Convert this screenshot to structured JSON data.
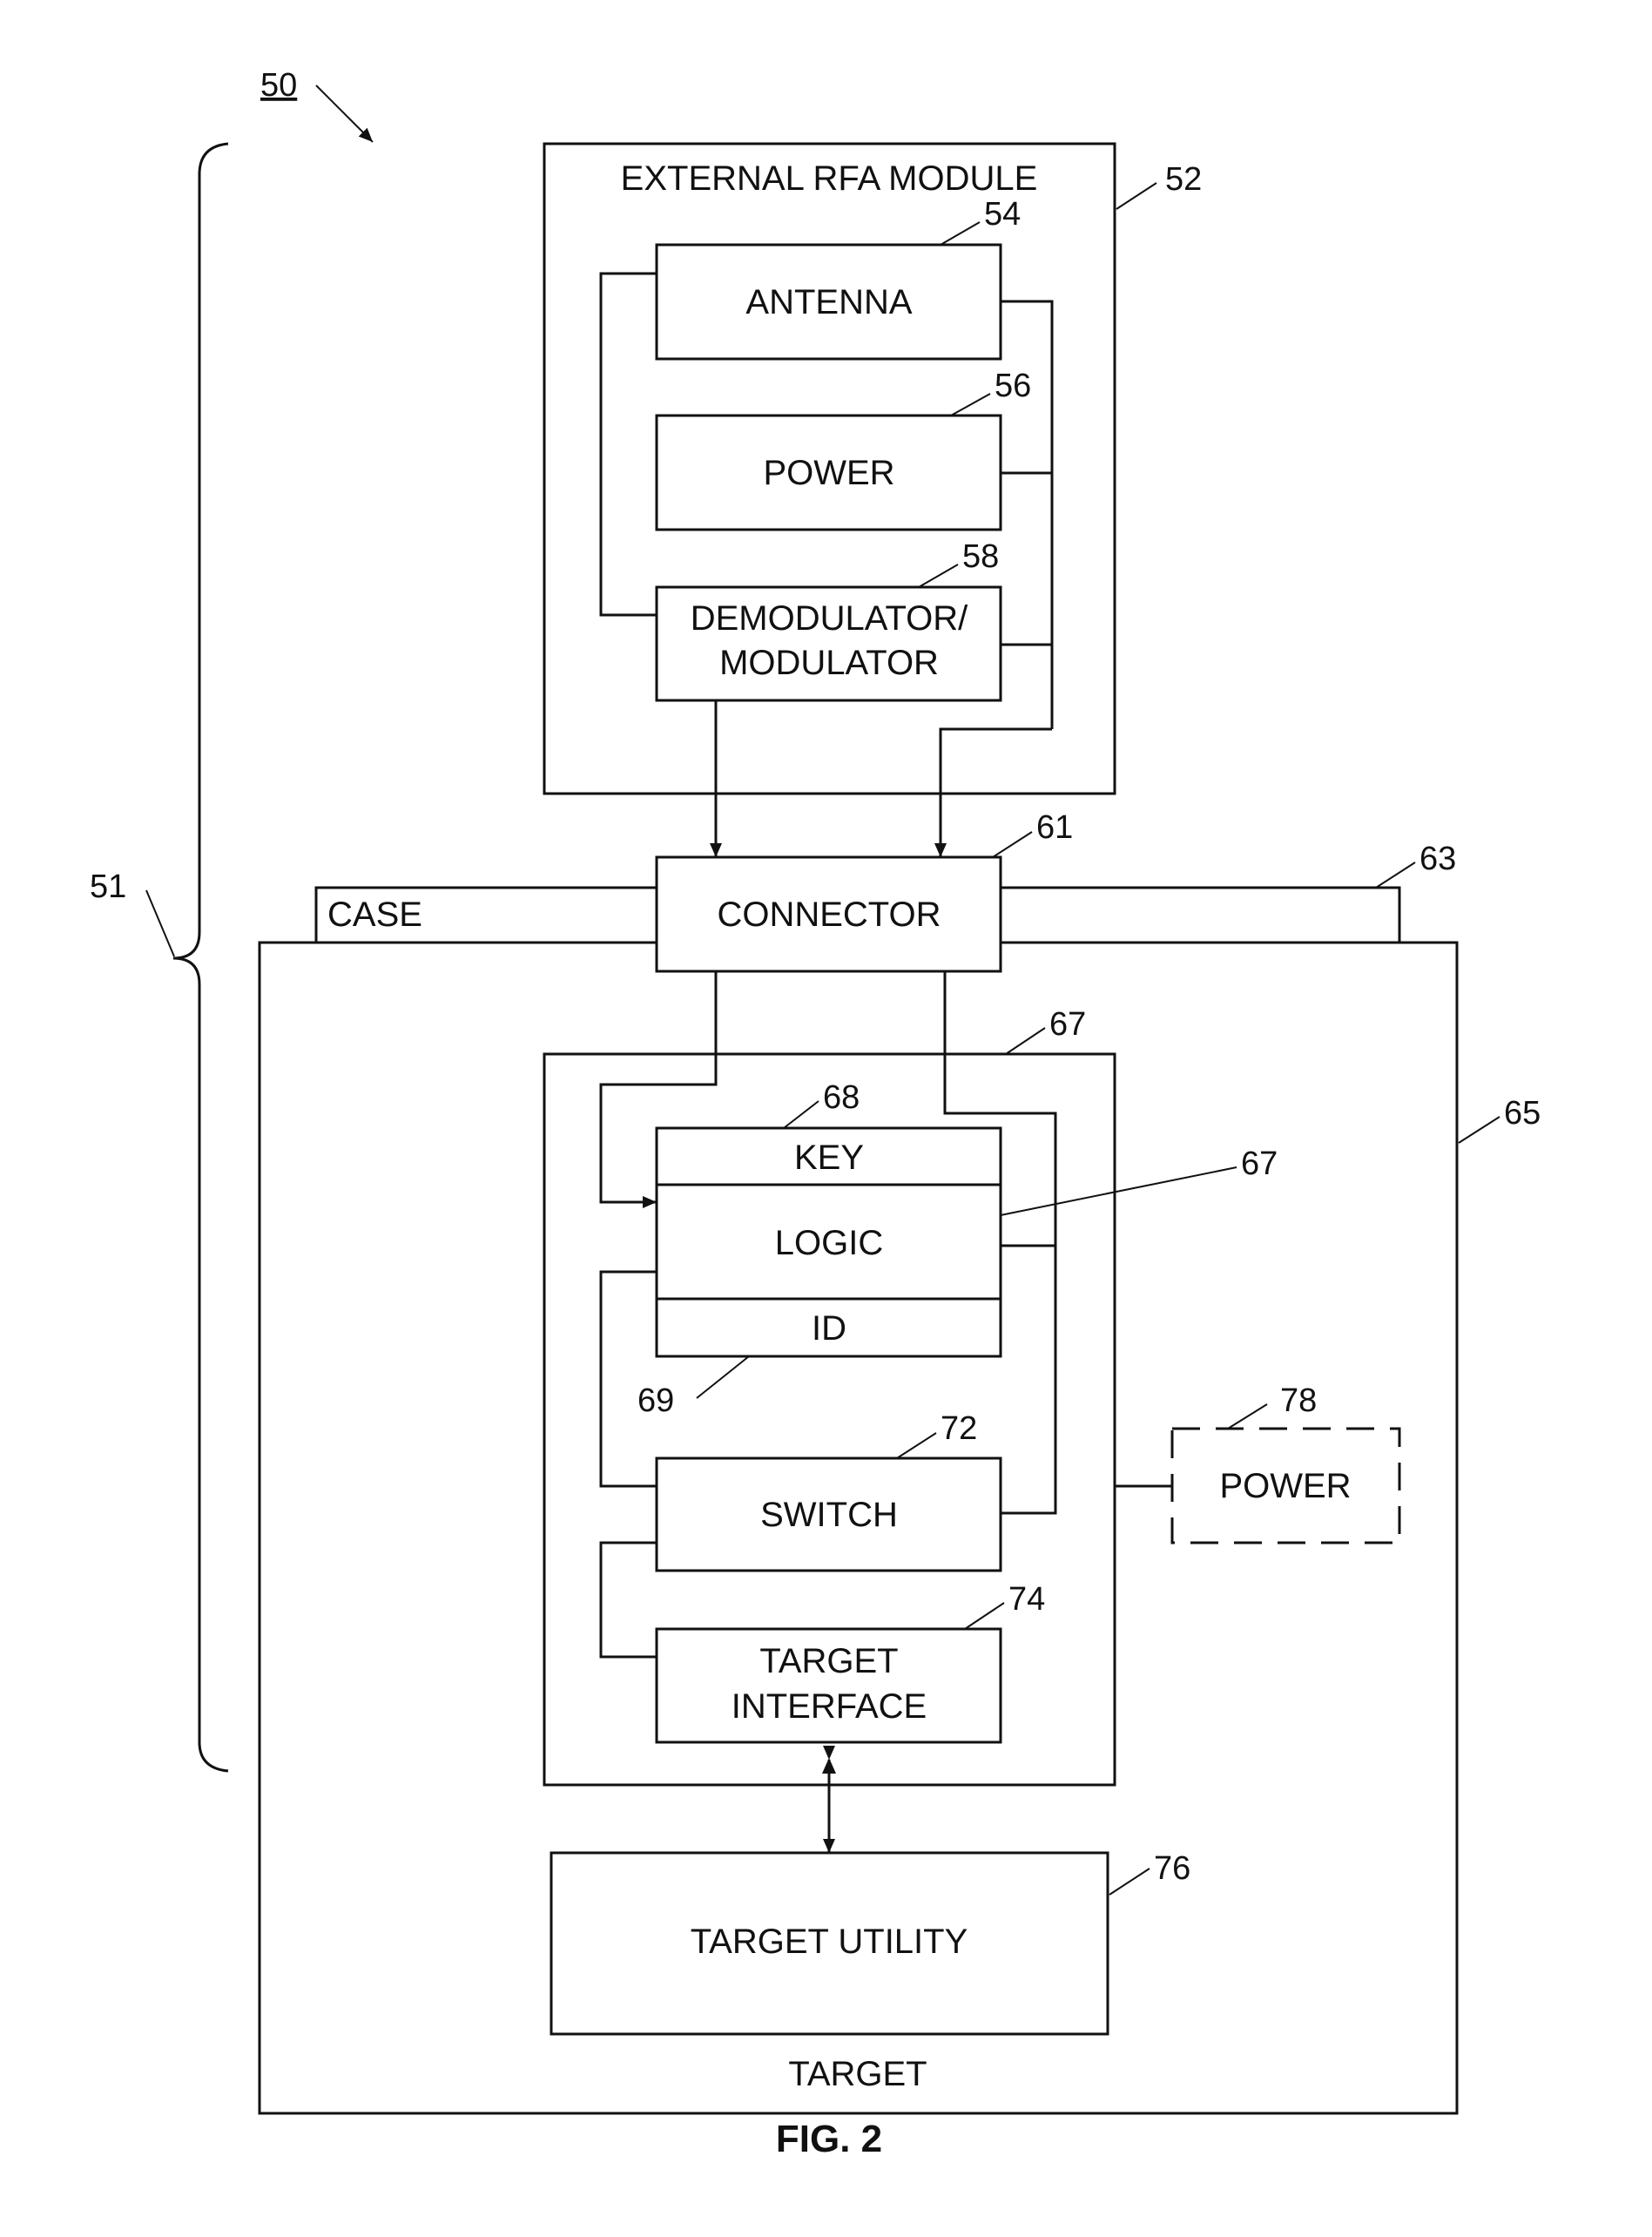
{
  "figure": {
    "caption": "FIG. 2",
    "system_ref": "50",
    "bracket_ref": "51"
  },
  "external_module": {
    "title": "EXTERNAL RFA MODULE",
    "ref": "52",
    "blocks": {
      "antenna": {
        "label": "ANTENNA",
        "ref": "54"
      },
      "power": {
        "label": "POWER",
        "ref": "56"
      },
      "demod_line1": "DEMODULATOR/",
      "demod_line2": "MODULATOR",
      "demod_ref": "58"
    }
  },
  "connector": {
    "label": "CONNECTOR",
    "ref": "61"
  },
  "case": {
    "label": "CASE",
    "ref": "63"
  },
  "target": {
    "label": "TARGET",
    "ref": "65",
    "module_ref": "67",
    "key": {
      "label": "KEY",
      "ref": "68"
    },
    "logic": {
      "label": "LOGIC",
      "ref": "67"
    },
    "id": {
      "label": "ID",
      "ref": "69"
    },
    "switch": {
      "label": "SWITCH",
      "ref": "72"
    },
    "target_interface_line1": "TARGET",
    "target_interface_line2": "INTERFACE",
    "target_interface_ref": "74",
    "target_utility": {
      "label": "TARGET UTILITY",
      "ref": "76"
    },
    "optional_power": {
      "label": "POWER",
      "ref": "78"
    }
  }
}
